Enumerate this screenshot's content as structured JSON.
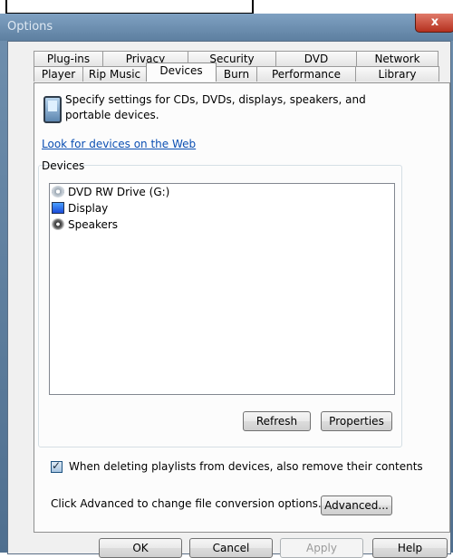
{
  "window": {
    "title": "Options",
    "close_label": "x"
  },
  "tabs": {
    "back_row": [
      {
        "label": "Plug-ins"
      },
      {
        "label": "Privacy"
      },
      {
        "label": "Security"
      },
      {
        "label": "DVD"
      },
      {
        "label": "Network"
      }
    ],
    "front_row": [
      {
        "label": "Player"
      },
      {
        "label": "Rip Music"
      },
      {
        "label": "Devices",
        "active": true
      },
      {
        "label": "Burn"
      },
      {
        "label": "Performance"
      },
      {
        "label": "Library"
      }
    ]
  },
  "panel": {
    "description": "Specify settings for CDs, DVDs, displays, speakers, and portable devices.",
    "web_link": "Look for devices on the Web",
    "devices_label": "Devices",
    "devices": [
      {
        "label": "DVD RW Drive (G:)",
        "icon": "dvd-drive-icon"
      },
      {
        "label": "Display",
        "icon": "display-icon"
      },
      {
        "label": "Speakers",
        "icon": "speaker-icon"
      }
    ],
    "refresh_label": "Refresh",
    "properties_label": "Properties",
    "checkbox_label": "When deleting playlists from devices, also remove their contents",
    "checkbox_checked": true,
    "advanced_text": "Click Advanced to change file conversion options.",
    "advanced_label": "Advanced..."
  },
  "footer": {
    "ok_label": "OK",
    "cancel_label": "Cancel",
    "apply_label": "Apply",
    "help_label": "Help"
  },
  "colors": {
    "link": "#0b4fb3",
    "title_bar": "#6f8fae",
    "close_button": "#c8412e"
  }
}
